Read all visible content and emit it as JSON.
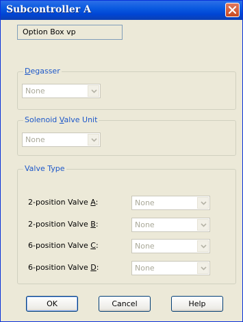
{
  "window": {
    "title": "Subcontroller A"
  },
  "option_box": {
    "value": "Option Box vp"
  },
  "degasser": {
    "label_pre": "",
    "label_key": "D",
    "label_post": "egasser",
    "value": "None"
  },
  "solenoid": {
    "label_pre": "Solenoid ",
    "label_key": "V",
    "label_post": "alve Unit",
    "value": "None"
  },
  "valve_type": {
    "label": "Valve Type",
    "rows": [
      {
        "label_pre": "2-position Valve ",
        "key": "A",
        "label_post": ":",
        "value": "None"
      },
      {
        "label_pre": "2-position Valve ",
        "key": "B",
        "label_post": ":",
        "value": "None"
      },
      {
        "label_pre": "6-position Valve ",
        "key": "C",
        "label_post": ":",
        "value": "None"
      },
      {
        "label_pre": "6-position Valve ",
        "key": "D",
        "label_post": ":",
        "value": "None"
      }
    ]
  },
  "buttons": {
    "ok": "OK",
    "cancel": "Cancel",
    "help": "Help"
  },
  "colors": {
    "title_bar": "#0a5ae0",
    "group_label": "#1c57c9",
    "dialog_bg": "#ece9d8"
  }
}
